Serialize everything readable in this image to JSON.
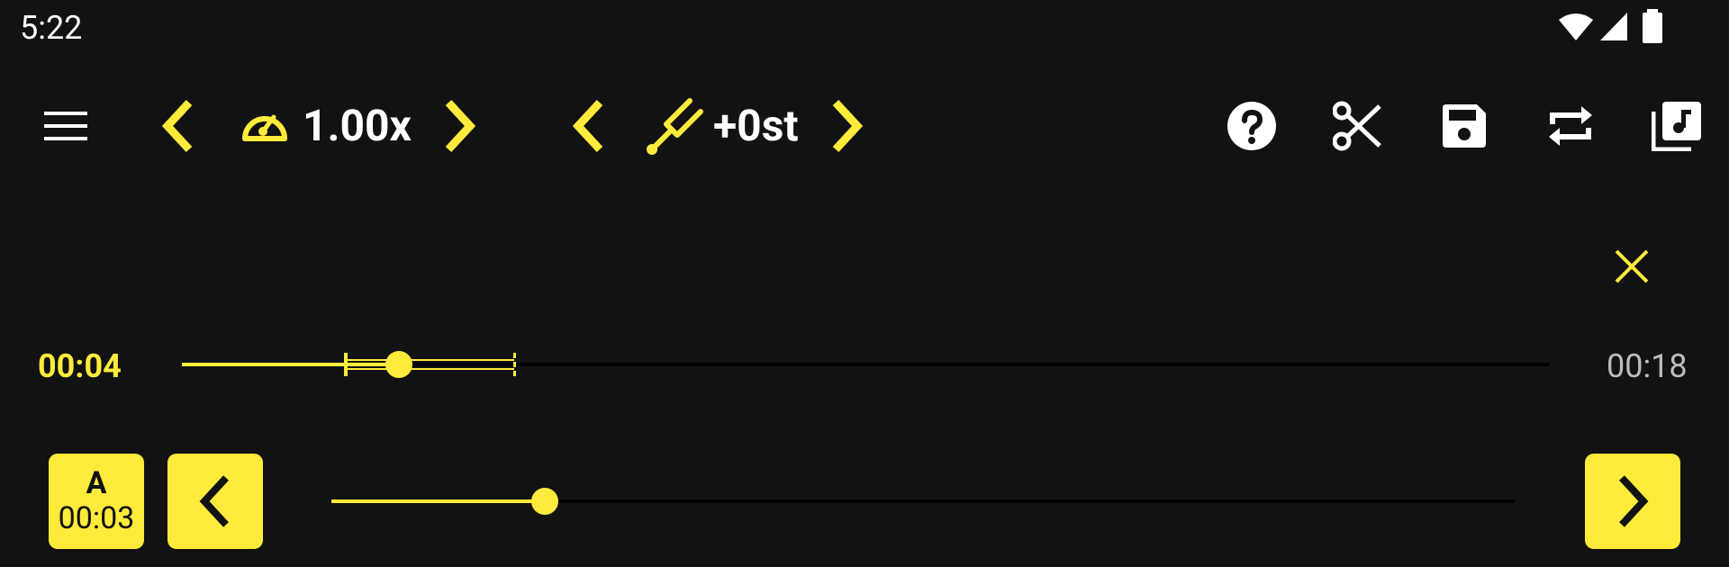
{
  "status_bar": {
    "time": "5:22",
    "icons": [
      "wifi-icon",
      "signal-icon",
      "battery-icon"
    ]
  },
  "toolbar": {
    "menu_icon": "menu-icon",
    "speed": {
      "value": "1.00x",
      "icon": "speedometer-icon"
    },
    "pitch": {
      "value": "+0st",
      "icon": "tuning-fork-icon"
    },
    "actions": [
      "help-icon",
      "scissors-icon",
      "save-icon",
      "repeat-icon",
      "music-library-icon"
    ]
  },
  "loop_bar": {
    "close_icon": "close-icon"
  },
  "progress": {
    "current_time": "00:04",
    "total_time": "00:18",
    "position_fraction": 0.159,
    "loop_start_fraction": 0.12,
    "loop_end_fraction": 0.243
  },
  "ab_controls": {
    "a_label": "A",
    "a_time": "00:03",
    "fine_slider_fraction": 0.18
  },
  "colors": {
    "accent": "#FFEB3B",
    "background": "#121212",
    "track": "#000000",
    "muted_text": "#BDBDBD"
  }
}
